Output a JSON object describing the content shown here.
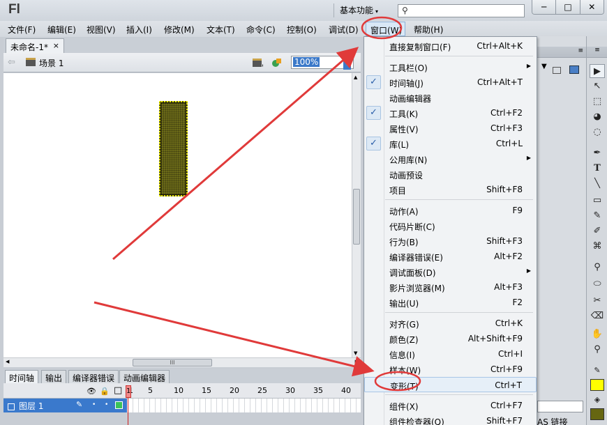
{
  "app": {
    "logo": "Fl",
    "workspace": "基本功能",
    "workspace_arrow": "▾",
    "search_value": "",
    "window_buttons": [
      "─",
      "□",
      "✕"
    ]
  },
  "menubar": {
    "items": [
      "文件(F)",
      "编辑(E)",
      "视图(V)",
      "插入(I)",
      "修改(M)",
      "文本(T)",
      "命令(C)",
      "控制(O)",
      "调试(D)",
      "窗口(W)",
      "帮助(H)"
    ],
    "active_index": 9
  },
  "document": {
    "tab_label": "未命名-1*",
    "tab_close": "×",
    "scene_label": "场景 1",
    "zoom": "100%"
  },
  "stage": {
    "background": "#ffffff",
    "rect_fill": "#6c6b18",
    "rect_stroke": "#f3f000"
  },
  "scrollbar": {
    "h_thumb_grip": "III"
  },
  "timeline": {
    "tabs": [
      "时间轴",
      "输出",
      "编译器错误",
      "动画编辑器"
    ],
    "frame_numbers": [
      "1",
      "5",
      "10",
      "15",
      "20",
      "25",
      "30",
      "35",
      "40"
    ],
    "current_frame": "1",
    "layer_name": "图层 1",
    "header_icons": {
      "eye": "👁",
      "lock": "🔒",
      "outline": "□"
    }
  },
  "window_menu": {
    "items": [
      {
        "label": "直接复制窗口(F)",
        "shortcut": "Ctrl+Alt+K",
        "checked": false,
        "submenu": false
      },
      {
        "sep": true
      },
      {
        "label": "工具栏(O)",
        "shortcut": "",
        "checked": false,
        "submenu": true
      },
      {
        "label": "时间轴(J)",
        "shortcut": "Ctrl+Alt+T",
        "checked": true,
        "submenu": false
      },
      {
        "label": "动画编辑器",
        "shortcut": "",
        "checked": false,
        "submenu": false
      },
      {
        "label": "工具(K)",
        "shortcut": "Ctrl+F2",
        "checked": true,
        "submenu": false
      },
      {
        "label": "属性(V)",
        "shortcut": "Ctrl+F3",
        "checked": false,
        "submenu": false
      },
      {
        "label": "库(L)",
        "shortcut": "Ctrl+L",
        "checked": true,
        "submenu": false
      },
      {
        "label": "公用库(N)",
        "shortcut": "",
        "checked": false,
        "submenu": true
      },
      {
        "label": "动画预设",
        "shortcut": "",
        "checked": false,
        "submenu": false
      },
      {
        "label": "项目",
        "shortcut": "Shift+F8",
        "checked": false,
        "submenu": false
      },
      {
        "sep": true
      },
      {
        "label": "动作(A)",
        "shortcut": "F9",
        "checked": false,
        "submenu": false
      },
      {
        "label": "代码片断(C)",
        "shortcut": "",
        "checked": false,
        "submenu": false
      },
      {
        "label": "行为(B)",
        "shortcut": "Shift+F3",
        "checked": false,
        "submenu": false
      },
      {
        "label": "编译器错误(E)",
        "shortcut": "Alt+F2",
        "checked": false,
        "submenu": false
      },
      {
        "label": "调试面板(D)",
        "shortcut": "",
        "checked": false,
        "submenu": true
      },
      {
        "label": "影片浏览器(M)",
        "shortcut": "Alt+F3",
        "checked": false,
        "submenu": false
      },
      {
        "label": "输出(U)",
        "shortcut": "F2",
        "checked": false,
        "submenu": false
      },
      {
        "sep": true
      },
      {
        "label": "对齐(G)",
        "shortcut": "Ctrl+K",
        "checked": false,
        "submenu": false
      },
      {
        "label": "颜色(Z)",
        "shortcut": "Alt+Shift+F9",
        "checked": false,
        "submenu": false
      },
      {
        "label": "信息(I)",
        "shortcut": "Ctrl+I",
        "checked": false,
        "submenu": false
      },
      {
        "label": "样本(W)",
        "shortcut": "Ctrl+F9",
        "checked": false,
        "submenu": false
      },
      {
        "label": "变形(T)",
        "shortcut": "Ctrl+T",
        "checked": false,
        "submenu": false,
        "highlighted": true
      },
      {
        "sep": true
      },
      {
        "label": "组件(X)",
        "shortcut": "Ctrl+F7",
        "checked": false,
        "submenu": false
      },
      {
        "label": "组件检查器(Q)",
        "shortcut": "Shift+F7",
        "checked": false,
        "submenu": false
      }
    ],
    "submenu_arrow": "▶",
    "check_mark": "✓"
  },
  "right_panel": {
    "aslink_label": "AS 链接"
  },
  "tools": {
    "icons": [
      "▶",
      "↖",
      "⬚",
      "◕",
      "◌",
      "✒",
      "T",
      "╲",
      "▭",
      "✎",
      "✐",
      "⌘",
      "⚲",
      "⬭",
      "✂",
      "⌫",
      "✋",
      "⚲"
    ],
    "stroke_color": "#ffff00",
    "fill_color": "#666611"
  },
  "annotations": {
    "color": "#e03a3a"
  }
}
